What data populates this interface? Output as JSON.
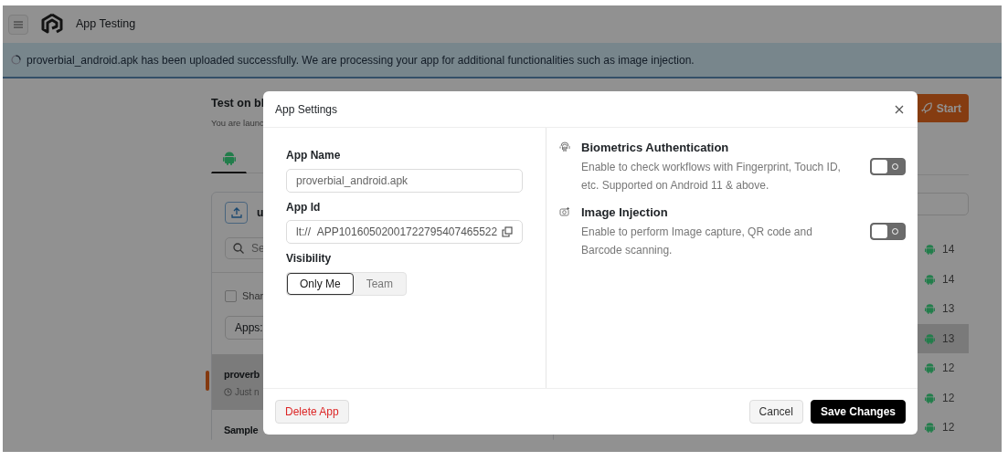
{
  "header": {
    "title": "App Testing"
  },
  "alert": {
    "message": "proverbial_android.apk has been uploaded successfully. We are processing your app for additional functionalities such as image injection."
  },
  "page": {
    "title": "Test on bl",
    "subtitle": "You are launc",
    "platform_tab": {
      "kind": "android",
      "selected": true
    },
    "upload_label": "u",
    "search": {
      "placeholder": "Se"
    },
    "share_checkbox": {
      "label": "Shar",
      "checked": false
    },
    "apps_filter": "Apps:",
    "apps": [
      {
        "name": "proverb",
        "time": "Just n",
        "selected": true
      },
      {
        "name": "Sample",
        "selected": false
      }
    ],
    "start_button": "Start",
    "versions": [
      {
        "label": "14",
        "selected": false
      },
      {
        "label": "14",
        "selected": false
      },
      {
        "label": "13",
        "selected": false
      },
      {
        "label": "13",
        "selected": true
      },
      {
        "label": "12",
        "selected": false
      },
      {
        "label": "12",
        "selected": false
      },
      {
        "label": "12",
        "selected": false
      }
    ]
  },
  "modal": {
    "title": "App Settings",
    "app_name": {
      "label": "App Name",
      "value": "proverbial_android.apk"
    },
    "app_id": {
      "label": "App Id",
      "prefix": "lt://",
      "value": "APP10160502001722795407465522"
    },
    "visibility": {
      "label": "Visibility",
      "options": [
        {
          "label": "Only Me",
          "selected": true
        },
        {
          "label": "Team",
          "selected": false
        }
      ]
    },
    "features": [
      {
        "kind": "biometrics",
        "title": "Biometrics Authentication",
        "description": "Enable to check workflows with Fingerprint, Touch ID, etc. Supported on Android 11 & above.",
        "on": false
      },
      {
        "kind": "image",
        "title": "Image Injection",
        "description": "Enable to perform Image capture, QR code and Barcode scanning.",
        "on": false
      }
    ],
    "buttons": [
      {
        "kind": "danger",
        "label": "Delete App"
      },
      {
        "kind": "secondary",
        "label": "Cancel"
      },
      {
        "kind": "primary",
        "label": "Save Changes"
      }
    ]
  }
}
